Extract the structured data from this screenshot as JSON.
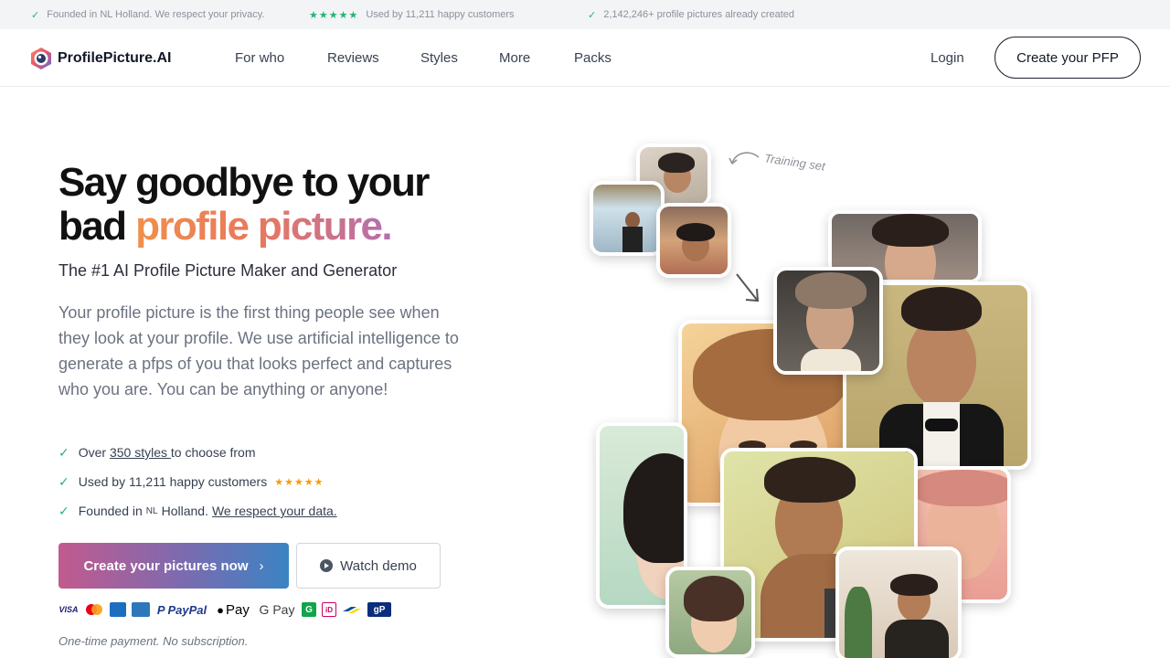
{
  "topbar": {
    "item1": "Founded in NL Holland. We respect your privacy.",
    "item2": "Used by 11,211 happy customers",
    "item3": "2,142,246+ profile pictures already created",
    "stars": "★★★★★",
    "check": "✓"
  },
  "nav": {
    "logo": "ProfilePicture.AI",
    "links": [
      "For who",
      "Reviews",
      "Styles",
      "More",
      "Packs"
    ],
    "login": "Login",
    "cta": "Create your PFP"
  },
  "hero": {
    "title_line1": "Say goodbye to your",
    "title_line2_plain": "bad ",
    "title_line2_grad": "profile picture.",
    "subtitle": "The #1 AI Profile Picture Maker and Generator",
    "description": "Your profile picture is the first thing people see when they look at your profile. We use artificial intelligence to generate a pfps of you that looks perfect and captures who you are. You can be anything or anyone!",
    "features": {
      "f1_pre": "Over ",
      "f1_link": "350 styles ",
      "f1_post": "to choose from",
      "f2": "Used by 11,211 happy customers",
      "f3_pre": "Founded in",
      "f3_nl": "NL",
      "f3_mid": "Holland.",
      "f3_link": "We respect your data."
    },
    "stars": "★★★★★",
    "check": "✓",
    "primary_button": "Create your pictures now",
    "primary_chevron": "›",
    "secondary_button": "Watch demo",
    "payment_methods": [
      "VISA",
      "Mastercard",
      "Amex",
      "PayPal",
      "Apple Pay",
      "G Pay",
      "G",
      "iD",
      "Bancontact",
      "gP"
    ],
    "payment_labels": {
      "visa": "VISA",
      "paypal": "PayPal",
      "applepay": "Pay",
      "gpay": "G Pay",
      "gp": "gP"
    },
    "note": "One-time payment. No subscription."
  },
  "collage": {
    "training_label": "Training set"
  },
  "colors": {
    "accent_green": "#22b573",
    "gradient_start": "#f0904a",
    "gradient_end": "#b36fb0",
    "button_start": "#c25a8e",
    "button_end": "#3a84c4"
  }
}
